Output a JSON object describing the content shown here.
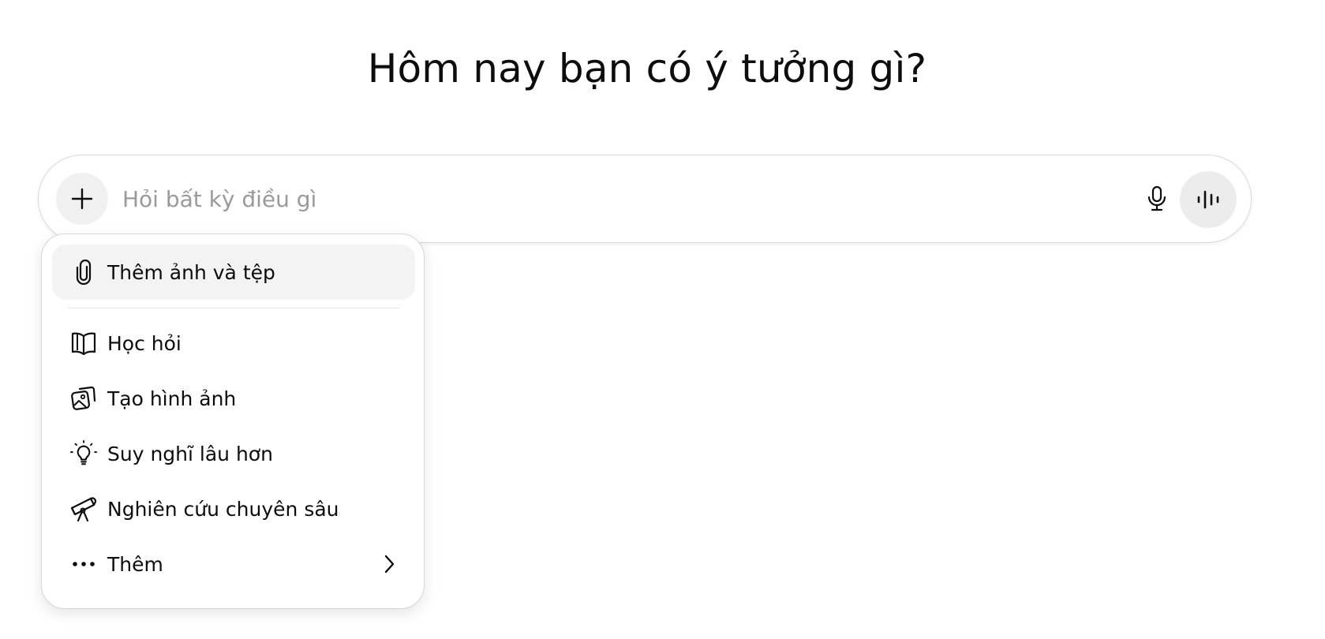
{
  "heading": "Hôm nay bạn có ý tưởng gì?",
  "composer": {
    "placeholder": "Hỏi bất kỳ điều gì",
    "value": "",
    "add_icon": "plus-icon",
    "mic_icon": "microphone-icon",
    "voice_icon": "voice-waveform-icon"
  },
  "menu": {
    "items": [
      {
        "label": "Thêm ảnh và tệp",
        "icon": "paperclip-icon",
        "highlighted": true
      },
      {
        "label": "Học hỏi",
        "icon": "open-book-icon"
      },
      {
        "label": "Tạo hình ảnh",
        "icon": "image-stack-icon"
      },
      {
        "label": "Suy nghĩ lâu hơn",
        "icon": "lightbulb-icon"
      },
      {
        "label": "Nghiên cứu chuyên sâu",
        "icon": "telescope-icon"
      },
      {
        "label": "Thêm",
        "icon": "ellipsis-icon",
        "submenu_icon": "chevron-right-icon"
      }
    ]
  },
  "colors": {
    "text": "#0d0d0d",
    "placeholder": "#9a9a9a",
    "border": "#d9d9d9",
    "button_bg": "#f0f0f0",
    "menu_highlight": "#f3f3f3"
  }
}
